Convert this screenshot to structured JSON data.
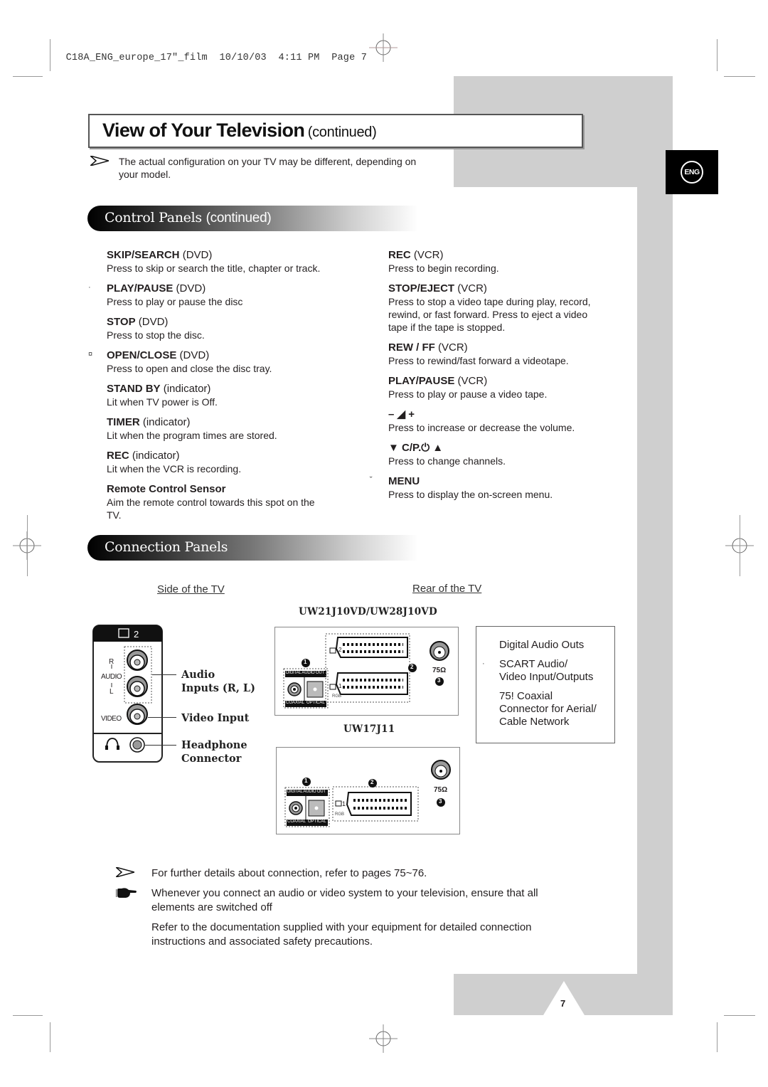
{
  "print_slug": {
    "file": "C18A_ENG_europe_17\"_film",
    "date": "10/10/03",
    "time": "4:11 PM",
    "page_label": "Page 7"
  },
  "language_tab": {
    "label": "ENG"
  },
  "title": {
    "main": "View of Your Television",
    "sub": "(continued)"
  },
  "intro_note": {
    "icon": "arrow-pointer-icon",
    "text_line1": "The actual configuration on your TV may be different, depending on",
    "text_line2": "your model."
  },
  "control_panels": {
    "heading": "Control Panels",
    "heading_sub": "(continued)",
    "left_items": [
      {
        "marker": "",
        "name": "SKIP/SEARCH",
        "qualifier": "(DVD)",
        "desc": [
          "Press to skip or search the title, chapter or track."
        ]
      },
      {
        "marker": "·",
        "name": "PLAY/PAUSE",
        "qualifier": "(DVD)",
        "desc": [
          "Press to play or pause the disc"
        ]
      },
      {
        "marker": "",
        "name": "STOP",
        "qualifier": "(DVD)",
        "desc": [
          "Press to stop the disc."
        ]
      },
      {
        "marker": "¤",
        "name": "OPEN/CLOSE",
        "qualifier": "(DVD)",
        "desc": [
          "Press to open and close the disc tray."
        ]
      },
      {
        "marker": "",
        "name": "STAND BY",
        "qualifier": "(indicator)",
        "desc": [
          "Lit when TV power is Off."
        ]
      },
      {
        "marker": "",
        "name": "TIMER",
        "qualifier": "(indicator)",
        "desc": [
          "Lit when the program times are stored."
        ]
      },
      {
        "marker": "",
        "name": "REC",
        "qualifier": "(indicator)",
        "desc": [
          "Lit when the VCR is recording."
        ]
      },
      {
        "marker": "",
        "name": "Remote Control Sensor",
        "qualifier": "",
        "desc": [
          "Aim the remote control towards this spot on the",
          "TV."
        ]
      }
    ],
    "right_items": [
      {
        "marker": "",
        "name": "REC",
        "qualifier": "(VCR)",
        "desc": [
          "Press to begin recording."
        ]
      },
      {
        "marker": "",
        "name": "STOP/EJECT",
        "qualifier": "(VCR)",
        "desc": [
          "Press to stop a video tape during play, record,",
          "rewind, or fast forward. Press to eject a video",
          "tape if the tape is stopped."
        ]
      },
      {
        "marker": "",
        "name": "REW / FF",
        "qualifier": "(VCR)",
        "desc": [
          "Press to rewind/fast forward a videotape."
        ]
      },
      {
        "marker": "",
        "name": "PLAY/PAUSE",
        "qualifier": "(VCR)",
        "desc": [
          "Press to play or pause a video tape."
        ]
      },
      {
        "marker": "",
        "name": "– ◢ +",
        "qualifier": "",
        "icon": "volume-icon",
        "desc": [
          "Press to increase or decrease the volume."
        ]
      },
      {
        "marker": "",
        "name": "▼ C/P.⏻ ▲",
        "qualifier": "",
        "icon": "channel-icon",
        "desc": [
          "Press to change channels."
        ]
      },
      {
        "marker": "˘",
        "name": "MENU",
        "qualifier": "",
        "desc": [
          "Press to display the on-screen menu."
        ]
      }
    ]
  },
  "connection_panels": {
    "heading": "Connection Panels",
    "side_label": "Side of the TV",
    "rear_label": "Rear of the TV",
    "side_panel": {
      "input_label": "2",
      "audio_label": "AUDIO",
      "r_label": "R",
      "l_label": "L",
      "video_label": "VIDEO",
      "callouts": {
        "audio_line1": "Audio",
        "audio_line2": "Inputs (R, L)",
        "video": "Video Input",
        "headphone_line1": "Headphone",
        "headphone_line2": "Connector"
      }
    },
    "rear_panels": [
      {
        "model": "UW21J10VD/UW28J10VD",
        "digital_audio_out": "DIGITAL AUDIO OUT",
        "coaxial": "COAXIAL",
        "optical": "OPTICAL",
        "scart_inputs": [
          "2",
          "1"
        ],
        "rgb": "RGB",
        "antenna": "75Ω",
        "markers": [
          "1",
          "2",
          "3"
        ]
      },
      {
        "model": "UW17J11",
        "digital_audio_out": "DIGITAL AUDIO OUT",
        "coaxial": "COAXIAL",
        "optical": "OPTICAL",
        "scart_inputs": [
          "1"
        ],
        "rgb": "RGB",
        "antenna": "75Ω",
        "markers": [
          "1",
          "2",
          "3"
        ]
      }
    ],
    "legend": [
      {
        "marker": "",
        "lines": [
          "Digital Audio Outs"
        ]
      },
      {
        "marker": "·",
        "lines": [
          "SCART Audio/",
          "Video Input/Outputs"
        ]
      },
      {
        "marker": "",
        "lines": [
          "75!   Coaxial",
          "Connector for Aerial/",
          "Cable Network"
        ]
      }
    ]
  },
  "footer_notes": [
    {
      "icon": "arrow-pointer-icon",
      "lines": [
        "For further details about connection, refer to pages 75~76."
      ]
    },
    {
      "icon": "pointing-hand-icon",
      "lines": [
        "Whenever you connect an audio or video system to your television, ensure that all",
        "elements are switched off"
      ]
    },
    {
      "icon": "",
      "lines": [
        "Refer to the documentation supplied with your equipment  for detailed connection",
        "instructions and associated safety precautions."
      ]
    }
  ],
  "page_number": "7"
}
